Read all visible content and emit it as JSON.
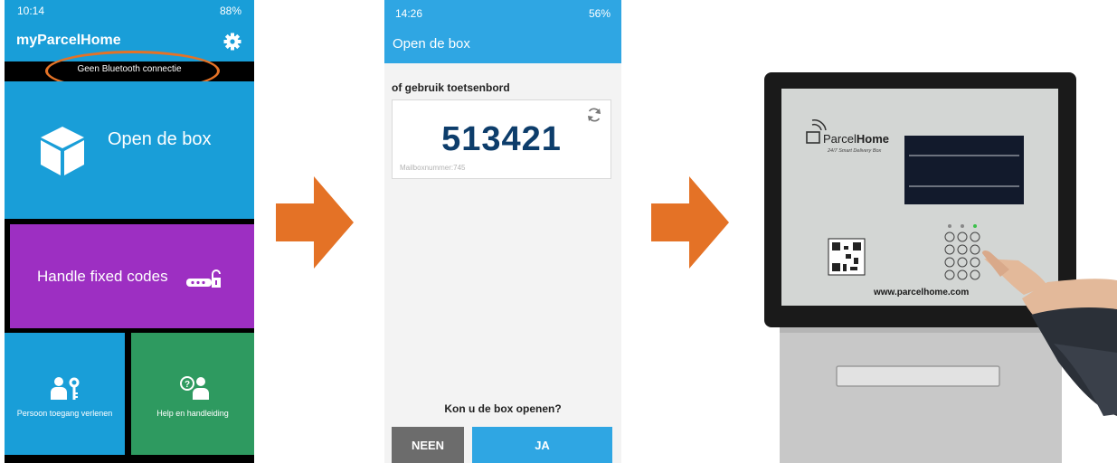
{
  "phone1": {
    "status_time": "10:14",
    "status_battery": "88%",
    "app_title": "myParcelHome",
    "bluetooth_message": "Geen Bluetooth connectie",
    "tiles": {
      "open_box": "Open de box",
      "fixed_codes": "Handle fixed codes",
      "grant_access": "Persoon toegang verlenen",
      "help": "Help en handleiding"
    }
  },
  "phone2": {
    "status_time": "14:26",
    "status_battery": "56%",
    "screen_title": "Open de box",
    "subtitle": "of gebruik toetsenbord",
    "code": "513421",
    "mailbox_label": "Mailboxnummer:745",
    "question": "Kon u de box openen?",
    "button_no": "NEEN",
    "button_yes": "JA"
  },
  "device": {
    "brand_prefix": "Parcel",
    "brand_suffix": "Home",
    "tagline": "24/7 Smart Delivery Box",
    "website": "www.parcelhome.com"
  },
  "colors": {
    "accent_blue": "#199ed8",
    "purple": "#9d2fc2",
    "green": "#2e9a60",
    "arrow_orange": "#e47226",
    "code_navy": "#0d3d6b"
  }
}
